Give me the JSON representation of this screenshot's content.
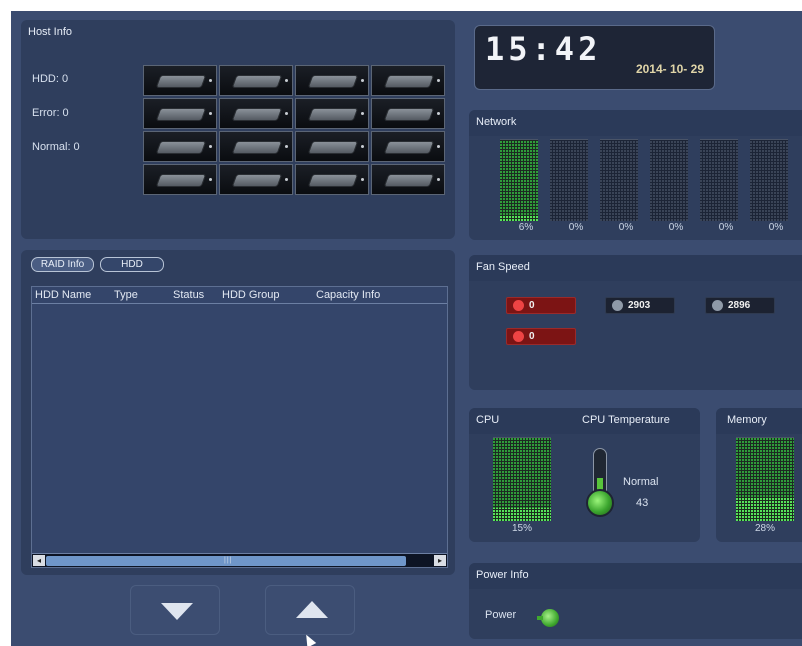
{
  "host_info": {
    "title": "Host Info",
    "hdd_label": "HDD: 0",
    "error_label": "Error: 0",
    "normal_label": "Normal: 0",
    "bay_rows": 4,
    "bay_cols": 4
  },
  "raid": {
    "tabs": [
      {
        "label": "RAID Info",
        "active": true
      },
      {
        "label": "HDD",
        "active": false
      }
    ],
    "columns": [
      "HDD Name",
      "Type",
      "Status",
      "HDD Group",
      "Capacity Info"
    ],
    "rows": [],
    "scroll_grip": "|||"
  },
  "clock": {
    "time": "15:42",
    "date": "2014- 10- 29"
  },
  "network": {
    "title": "Network",
    "channels": [
      {
        "percent": 6,
        "label": "6%",
        "active": true
      },
      {
        "percent": 0,
        "label": "0%",
        "active": false
      },
      {
        "percent": 0,
        "label": "0%",
        "active": false
      },
      {
        "percent": 0,
        "label": "0%",
        "active": false
      },
      {
        "percent": 0,
        "label": "0%",
        "active": false
      },
      {
        "percent": 0,
        "label": "0%",
        "active": false
      }
    ]
  },
  "fan_speed": {
    "title": "Fan Speed",
    "fans": [
      {
        "value": "0",
        "status": "alarm",
        "icon": "fan-icon"
      },
      {
        "value": "2903",
        "status": "ok",
        "icon": "fan-icon"
      },
      {
        "value": "2896",
        "status": "ok",
        "icon": "fan-icon"
      },
      {
        "value": "0",
        "status": "alarm",
        "icon": "fan-icon"
      }
    ]
  },
  "cpu": {
    "title": "CPU",
    "percent": 15,
    "label": "15%"
  },
  "cpu_temp": {
    "title": "CPU Temperature",
    "status": "Normal",
    "value": "43"
  },
  "memory": {
    "title": "Memory",
    "percent": 28,
    "label": "28%"
  },
  "power": {
    "title": "Power Info",
    "label": "Power",
    "icon": "power-plug-icon"
  },
  "nav": {
    "down_icon": "arrow-down-icon",
    "up_icon": "arrow-up-icon"
  },
  "colors": {
    "accent_green": "#56e35a",
    "alarm_red": "#7c1414",
    "panel": "#2f3e5d",
    "background": "#3b4c70"
  }
}
